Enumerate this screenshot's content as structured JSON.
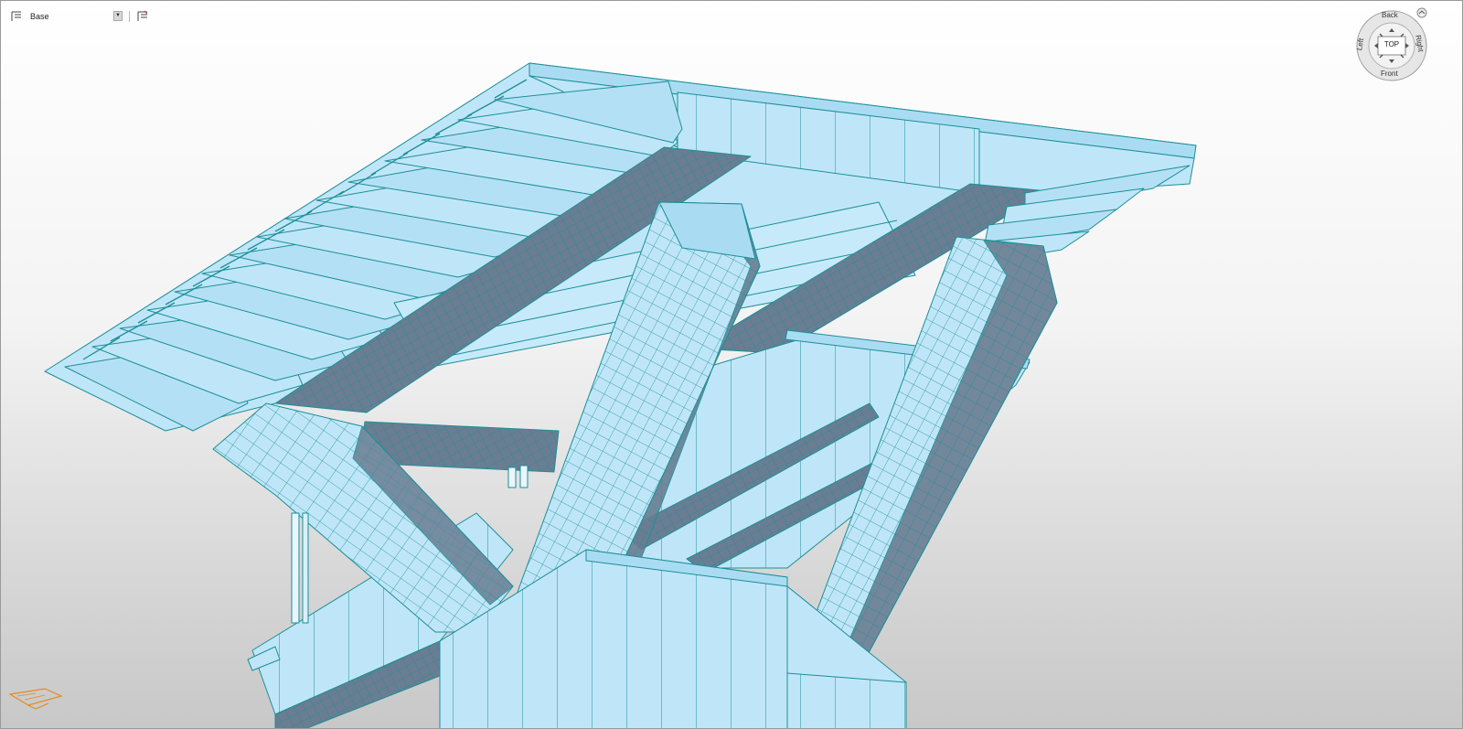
{
  "toolbar": {
    "level_name": "Base",
    "level_icon": "level-icon",
    "dropdown_icon": "chevron-down-icon",
    "section_icon": "level-section-icon"
  },
  "viewcube": {
    "top": "TOP",
    "back": "Back",
    "front": "Front",
    "left": "Left",
    "right": "Right",
    "home_icon": "home-icon"
  },
  "colors": {
    "steel_fill": "#bfe6f8",
    "steel_edge": "#1c8f97",
    "deck_plate": "#6b7d92",
    "background_top": "#ffffff",
    "background_bottom": "#c8c8c8",
    "marker": "#e58a1e"
  }
}
